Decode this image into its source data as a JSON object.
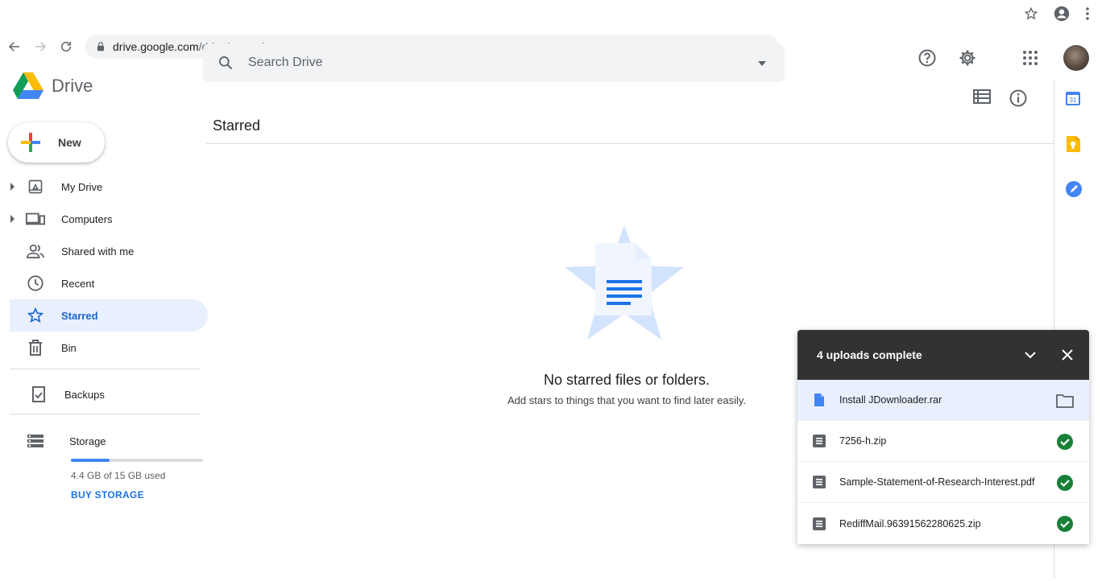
{
  "browser": {
    "url_host": "drive.google.com",
    "url_path": "/drive/starred"
  },
  "app": {
    "name": "Drive"
  },
  "search": {
    "placeholder": "Search Drive"
  },
  "sidebar": {
    "new_label": "New",
    "items": [
      {
        "label": "My Drive",
        "icon": "my-drive-icon",
        "expandable": true
      },
      {
        "label": "Computers",
        "icon": "computers-icon",
        "expandable": true
      },
      {
        "label": "Shared with me",
        "icon": "shared-with-me-icon",
        "expandable": false
      },
      {
        "label": "Recent",
        "icon": "clock-icon",
        "expandable": false
      },
      {
        "label": "Starred",
        "icon": "star-icon",
        "expandable": false,
        "active": true
      },
      {
        "label": "Bin",
        "icon": "trash-icon",
        "expandable": false
      }
    ],
    "backups_label": "Backups",
    "storage": {
      "label": "Storage",
      "used_text": "4.4 GB of 15 GB used",
      "used_fraction": 0.29,
      "buy_label": "BUY STORAGE"
    }
  },
  "main": {
    "title": "Starred",
    "empty_title": "No starred files or folders.",
    "empty_subtitle": "Add stars to things that you want to find later easily."
  },
  "uploads": {
    "title": "4 uploads complete",
    "items": [
      {
        "name": "Install JDownloader.rar",
        "status": "open-folder",
        "icon": "doc-blue"
      },
      {
        "name": "7256-h.zip",
        "status": "complete",
        "icon": "archive"
      },
      {
        "name": "Sample-Statement-of-Research-Interest.pdf",
        "status": "complete",
        "icon": "archive"
      },
      {
        "name": "RediffMail.96391562280625.zip",
        "status": "complete",
        "icon": "archive"
      }
    ]
  },
  "colors": {
    "accent": "#1a73e8",
    "active_bg": "#e8f0fe",
    "success": "#188038",
    "panel_header": "#323232"
  }
}
